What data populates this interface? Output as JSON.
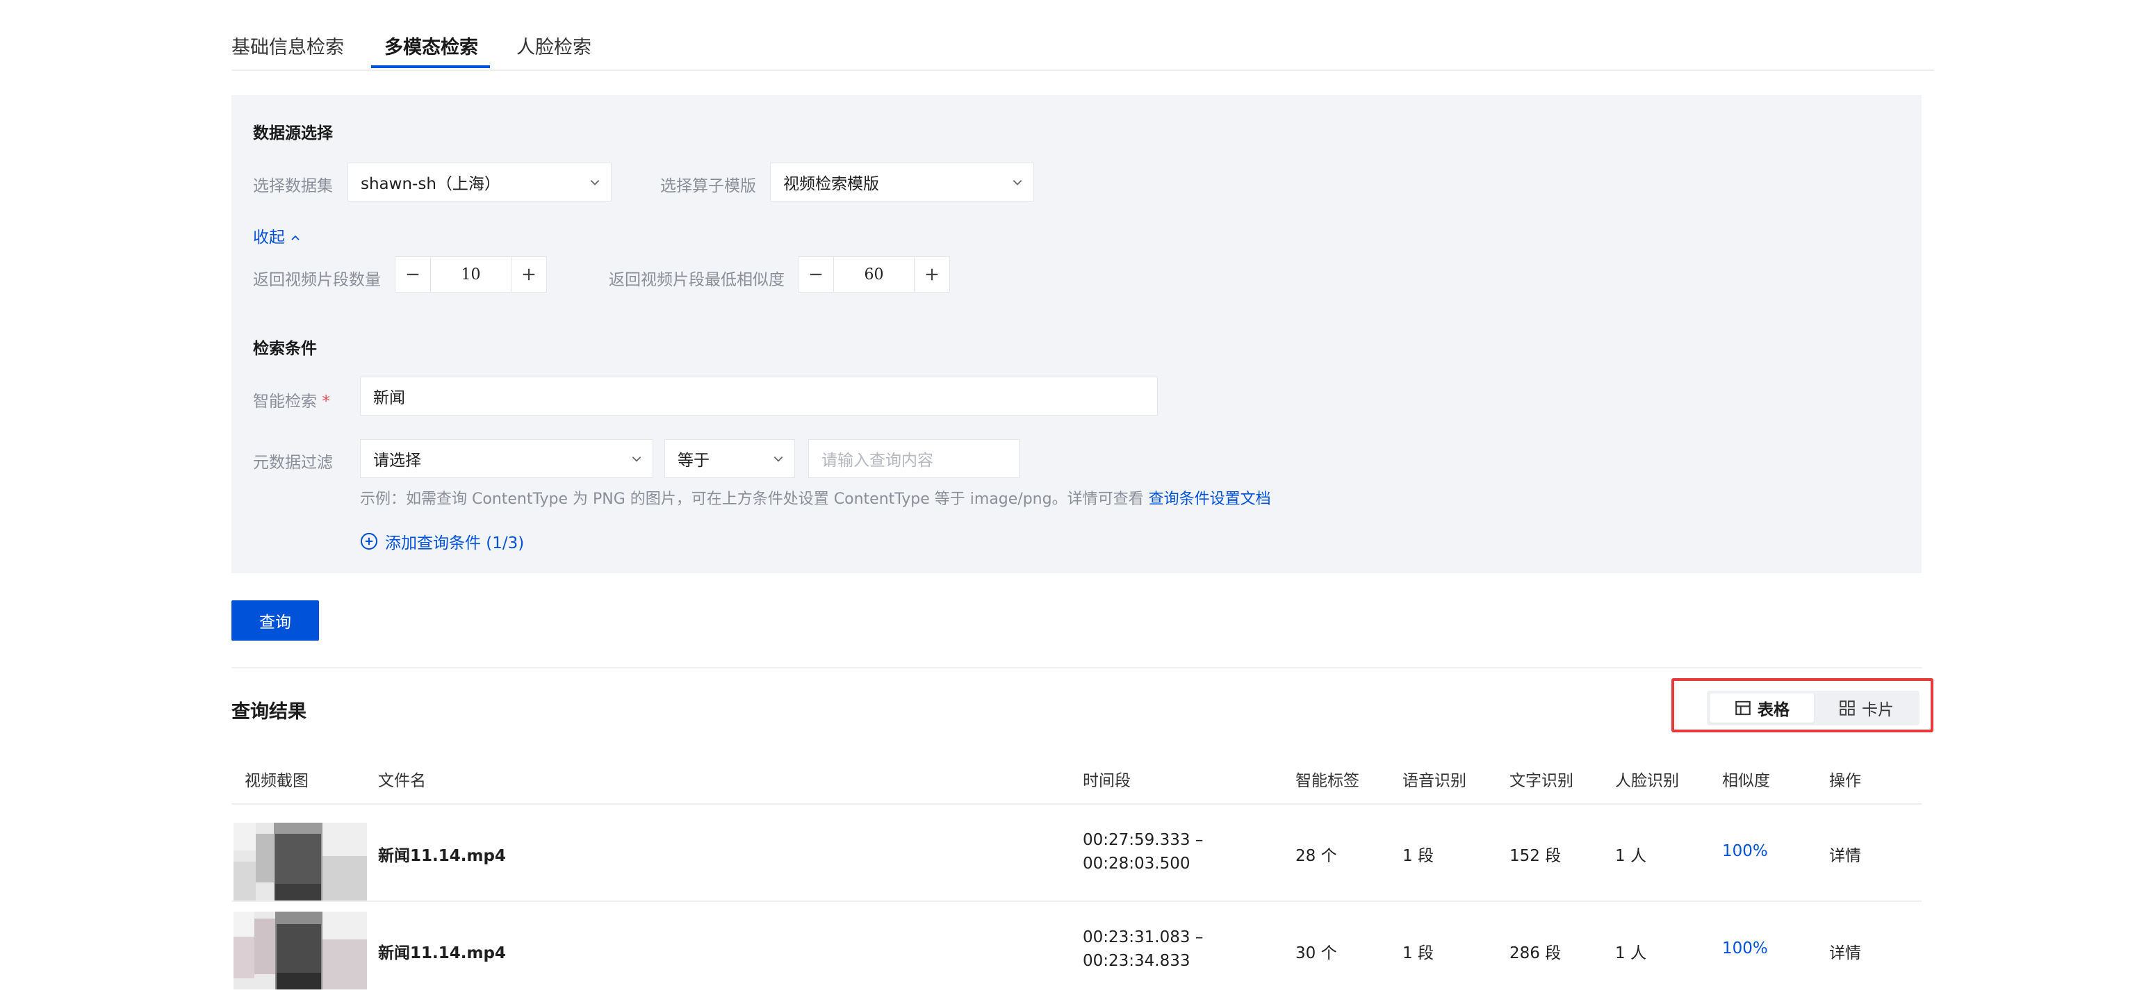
{
  "tabs": [
    {
      "label": "基础信息检索",
      "active": false
    },
    {
      "label": "多模态检索",
      "active": true
    },
    {
      "label": "人脸检索",
      "active": false
    }
  ],
  "data_source": {
    "title": "数据源选择",
    "dataset_label": "选择数据集",
    "dataset_value": "shawn-sh（上海）",
    "template_label": "选择算子模版",
    "template_value": "视频检索模版",
    "collapse_label": "收起",
    "segment_count_label": "返回视频片段数量",
    "segment_count_value": "10",
    "min_similarity_label": "返回视频片段最低相似度",
    "min_similarity_value": "60"
  },
  "conditions": {
    "title": "检索条件",
    "smart_label": "智能检索",
    "required_mark": "*",
    "smart_value": "新闻",
    "metadata_label": "元数据过滤",
    "metadata_field": "请选择",
    "operator": "等于",
    "query_placeholder": "请输入查询内容",
    "hint_text": "示例：如需查询 ContentType 为 PNG 的图片，可在上方条件处设置 ContentType 等于 image/png。详情可查看",
    "hint_link": "查询条件设置文档",
    "add_condition": "添加查询条件 (1/3)"
  },
  "query_button": "查询",
  "results": {
    "title": "查询结果",
    "view_table": "表格",
    "view_card": "卡片",
    "columns": [
      "视频截图",
      "文件名",
      "时间段",
      "智能标签",
      "语音识别",
      "文字识别",
      "人脸识别",
      "相似度",
      "操作"
    ],
    "rows": [
      {
        "filename": "新闻11.14.mp4",
        "time_start": "00:27:59.333 –",
        "time_end": "00:28:03.500",
        "tags": "28 个",
        "speech": "1 段",
        "ocr": "152 段",
        "faces": "1 人",
        "similarity": "100%",
        "action": "详情"
      },
      {
        "filename": "新闻11.14.mp4",
        "time_start": "00:23:31.083 –",
        "time_end": "00:23:34.833",
        "tags": "30 个",
        "speech": "1 段",
        "ocr": "286 段",
        "faces": "1 人",
        "similarity": "100%",
        "action": "详情"
      }
    ]
  },
  "colors": {
    "accent": "#0052d9",
    "panel_bg": "#f3f4f7",
    "highlight": "#e5393b",
    "required": "#e34d59"
  }
}
